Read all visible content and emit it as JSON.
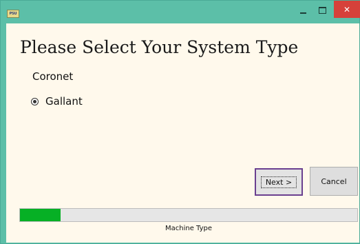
{
  "window": {
    "app_icon_text": "PSU",
    "close_glyph": "✕",
    "accent_color": "#5cbfa8"
  },
  "page": {
    "title": "Please Select Your System Type"
  },
  "options": [
    {
      "label": "Coronet",
      "selected": false
    },
    {
      "label": "Gallant",
      "selected": true
    }
  ],
  "buttons": {
    "next_label": "Next >",
    "cancel_label": "Cancel"
  },
  "progress": {
    "fraction": 0.12,
    "label": "Machine Type",
    "fill_color": "#06b025"
  }
}
